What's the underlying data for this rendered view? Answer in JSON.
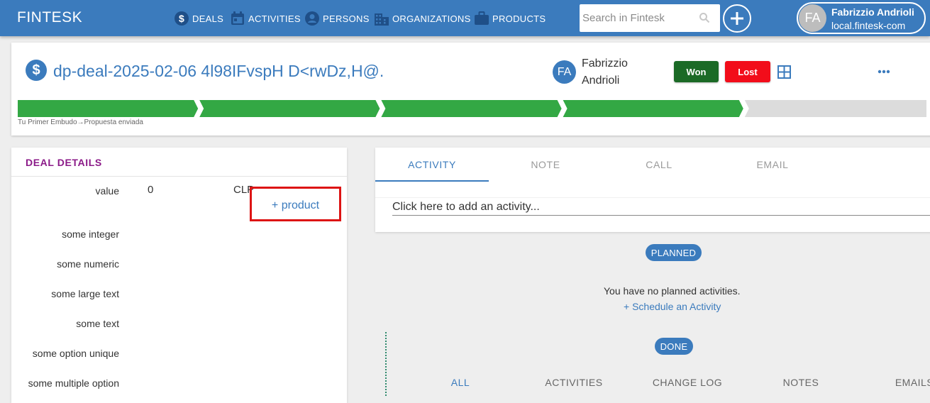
{
  "app": {
    "brand": "FINTESK"
  },
  "nav": {
    "items": [
      {
        "label": "DEALS",
        "icon": "dollar-circle-icon"
      },
      {
        "label": "ACTIVITIES",
        "icon": "calendar-icon"
      },
      {
        "label": "PERSONS",
        "icon": "person-circle-icon"
      },
      {
        "label": "ORGANIZATIONS",
        "icon": "building-icon"
      },
      {
        "label": "PRODUCTS",
        "icon": "briefcase-icon"
      }
    ],
    "search_placeholder": "Search in Fintesk"
  },
  "user": {
    "initials": "FA",
    "name": "Fabrizzio Andrioli",
    "org": "local.fintesk-com"
  },
  "deal": {
    "title": "dp-deal-2025-02-06 4l98IFvspH D<rwDz,H@.",
    "owner_initials": "FA",
    "owner_name": "Fabrizzio Andrioli",
    "won_label": "Won",
    "lost_label": "Lost",
    "stage_path": "Tu Primer Embudo→Propuesta enviada",
    "pipeline": {
      "total_stages": 5,
      "completed_stages": 4
    },
    "colors": {
      "stage_done": "#33a844",
      "stage_todo": "#dcdcdc",
      "accent": "#3b7bbd"
    }
  },
  "details": {
    "title": "DEAL DETAILS",
    "value_label": "value",
    "value": "0",
    "currency": "CLP",
    "add_product_label": "+ product",
    "fields": [
      "some integer",
      "some numeric",
      "some large text",
      "some text",
      "some option unique",
      "some multiple option"
    ]
  },
  "activity": {
    "tabs": [
      "ACTIVITY",
      "NOTE",
      "CALL",
      "EMAIL"
    ],
    "active_tab": "ACTIVITY",
    "input_placeholder": "Click here to add an activity...",
    "planned_label": "PLANNED",
    "empty_message": "You have no planned activities.",
    "schedule_link": "+ Schedule an Activity",
    "done_label": "DONE",
    "filter_tabs": [
      "ALL",
      "ACTIVITIES",
      "CHANGE LOG",
      "NOTES",
      "EMAILS"
    ]
  }
}
